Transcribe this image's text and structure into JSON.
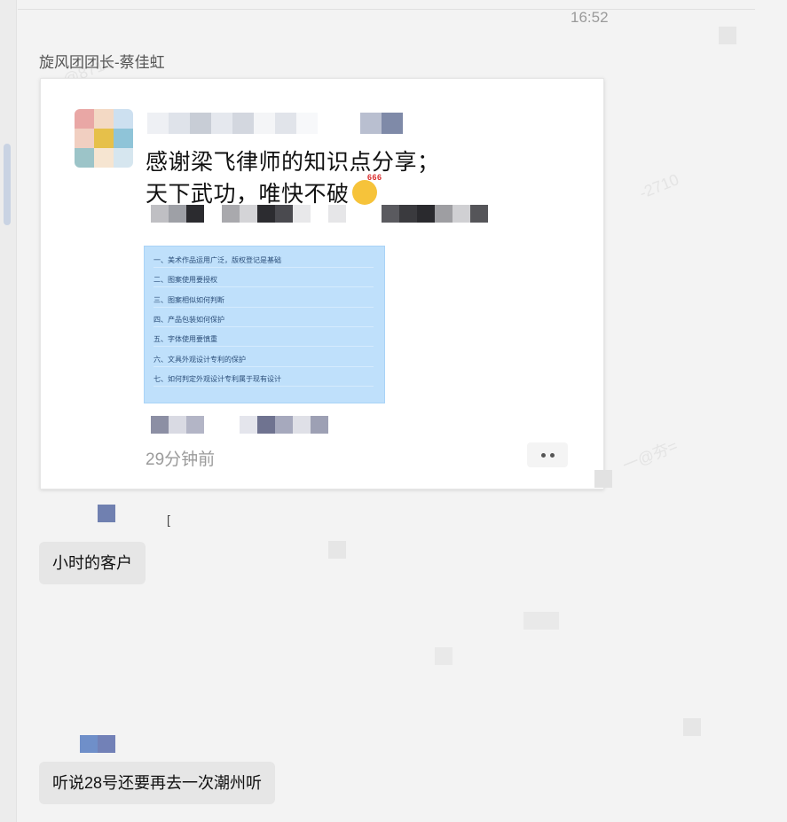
{
  "chat": {
    "timestamp": "16:52",
    "sender": "旋风团团长-蔡佳虹"
  },
  "moment_card": {
    "line1": "感谢梁飞律师的知识点分享；",
    "line2": "天下武功，唯快不破",
    "emoji": "face-666-emoji",
    "outline": [
      "一、美术作品运用广泛，版权登记是基础",
      "二、图案使用要授权",
      "三、图案相似如何判断",
      "四、产品包装如何保护",
      "五、字体使用要慎重",
      "六、文具外观设计专利的保护",
      "七、如何判定外观设计专利属于现有设计"
    ],
    "posted_ago": "29分钟前",
    "more_icon": "more-dots-icon"
  },
  "messages": [
    {
      "text": "小时的客户"
    },
    {
      "text": "听说28号还要再去一次潮州听"
    }
  ],
  "colors": {
    "background": "#f3f3f3",
    "bubble": "#e6e6e6",
    "outline_image": "#bfe0fb"
  }
}
